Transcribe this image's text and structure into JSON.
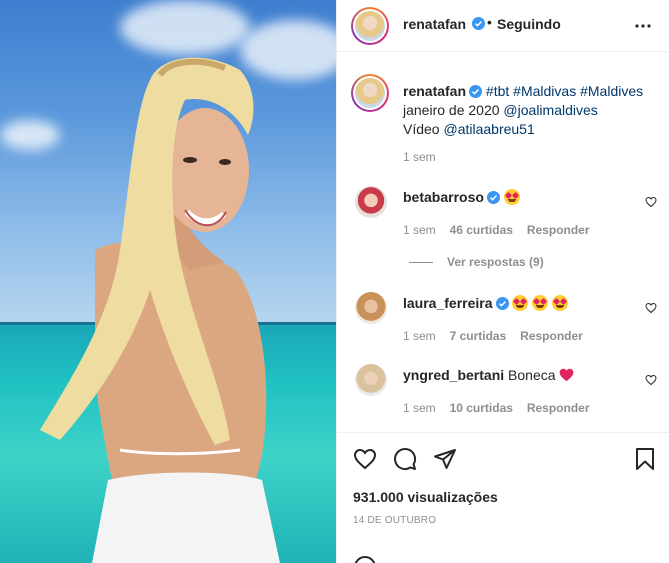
{
  "post": {
    "author": "renatafan",
    "follow_status": "Seguindo",
    "more_icon": "more-horizontal-icon"
  },
  "caption": {
    "username": "renatafan",
    "text_parts": [
      "#tbt",
      "#Maldivas",
      "#Maldives",
      "janeiro de 2020",
      "@joalimaldives",
      "Vídeo",
      "@atilaabreu51"
    ],
    "time": "1 sem"
  },
  "comments": [
    {
      "username": "betabarroso",
      "verified": true,
      "text": "",
      "emoji_count": 1,
      "time": "1 sem",
      "likes": "46 curtidas",
      "reply": "Responder",
      "view_replies": "Ver respostas (9)"
    },
    {
      "username": "laura_ferreira",
      "verified": true,
      "text": "",
      "emoji_count": 3,
      "time": "1 sem",
      "likes": "7 curtidas",
      "reply": "Responder"
    },
    {
      "username": "yngred_bertani",
      "verified": false,
      "text": "Boneca",
      "emoji": "red-heart",
      "time": "1 sem",
      "likes": "10 curtidas",
      "reply": "Responder"
    }
  ],
  "footer": {
    "views": "931.000 visualizações",
    "date": "14 DE OUTUBRO"
  },
  "colors": {
    "link": "#00376b",
    "verified": "#3897f0",
    "muted": "#8e8e8e"
  }
}
